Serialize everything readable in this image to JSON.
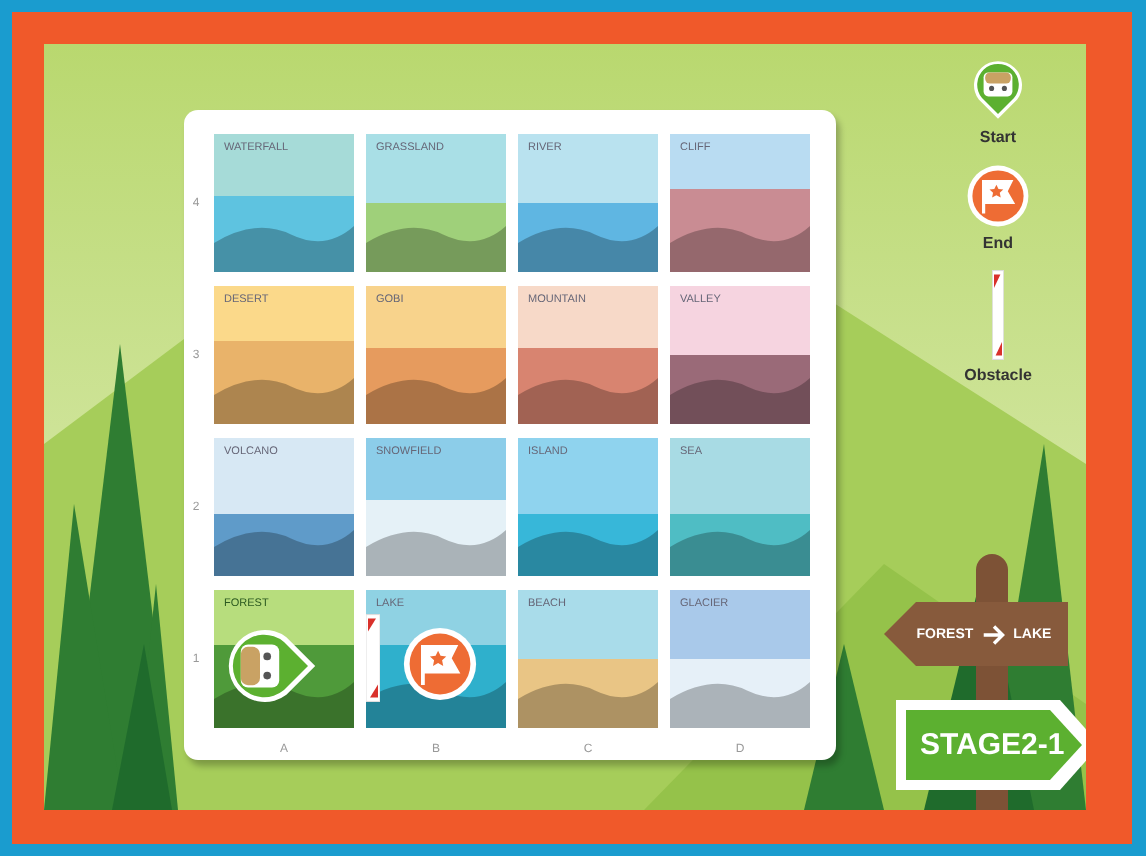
{
  "board": {
    "rows": [
      {
        "label": "4",
        "tiles": [
          {
            "label": "WATERFALL"
          },
          {
            "label": "GRASSLAND"
          },
          {
            "label": "RIVER"
          },
          {
            "label": "CLIFF"
          }
        ]
      },
      {
        "label": "3",
        "tiles": [
          {
            "label": "DESERT"
          },
          {
            "label": "GOBI"
          },
          {
            "label": "MOUNTAIN"
          },
          {
            "label": "VALLEY"
          }
        ]
      },
      {
        "label": "2",
        "tiles": [
          {
            "label": "VOLCANO"
          },
          {
            "label": "SNOWFIELD"
          },
          {
            "label": "ISLAND"
          },
          {
            "label": "SEA"
          }
        ]
      },
      {
        "label": "1",
        "tiles": [
          {
            "label": "FOREST",
            "start": true
          },
          {
            "label": "LAKE",
            "end": true,
            "obstacle_left": true
          },
          {
            "label": "BEACH"
          },
          {
            "label": "GLACIER"
          }
        ]
      }
    ],
    "columns": [
      "A",
      "B",
      "C",
      "D"
    ]
  },
  "legend": [
    {
      "kind": "start",
      "label": "Start"
    },
    {
      "kind": "end",
      "label": "End"
    },
    {
      "kind": "obstacle",
      "label": "Obstacle"
    }
  ],
  "signpost": {
    "from": "FOREST",
    "to": "LAKE"
  },
  "stage": "STAGE2-1"
}
